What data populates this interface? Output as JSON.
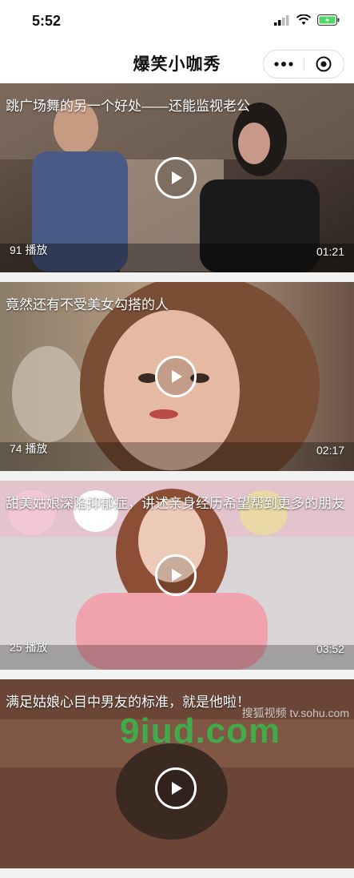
{
  "status": {
    "time": "5:52"
  },
  "nav": {
    "title": "爆笑小咖秀"
  },
  "videos": [
    {
      "title": "跳广场舞的另一个好处——还能监视老公",
      "plays": "91 播放",
      "duration": "01:21"
    },
    {
      "title": "竟然还有不受美女勾搭的人",
      "plays": "74 播放",
      "duration": "02:17"
    },
    {
      "title": "甜美姑娘深陷抑郁症，讲述亲身经历希望帮到更多的朋友",
      "plays": "25 播放",
      "duration": "03:52"
    },
    {
      "title": "满足姑娘心目中男友的标准，就是他啦！",
      "plays": "",
      "duration": ""
    }
  ],
  "watermark": {
    "source": "搜狐视频 tv.sohu.com",
    "site": "9iud.com"
  },
  "colors": {
    "nav_bg": "#ffffff",
    "page_bg": "#f2f2f2",
    "watermark_green": "#3bb54a"
  },
  "icons": [
    "signal-icon",
    "wifi-icon",
    "battery-icon",
    "more-icon",
    "close-capsule-icon",
    "play-icon"
  ]
}
